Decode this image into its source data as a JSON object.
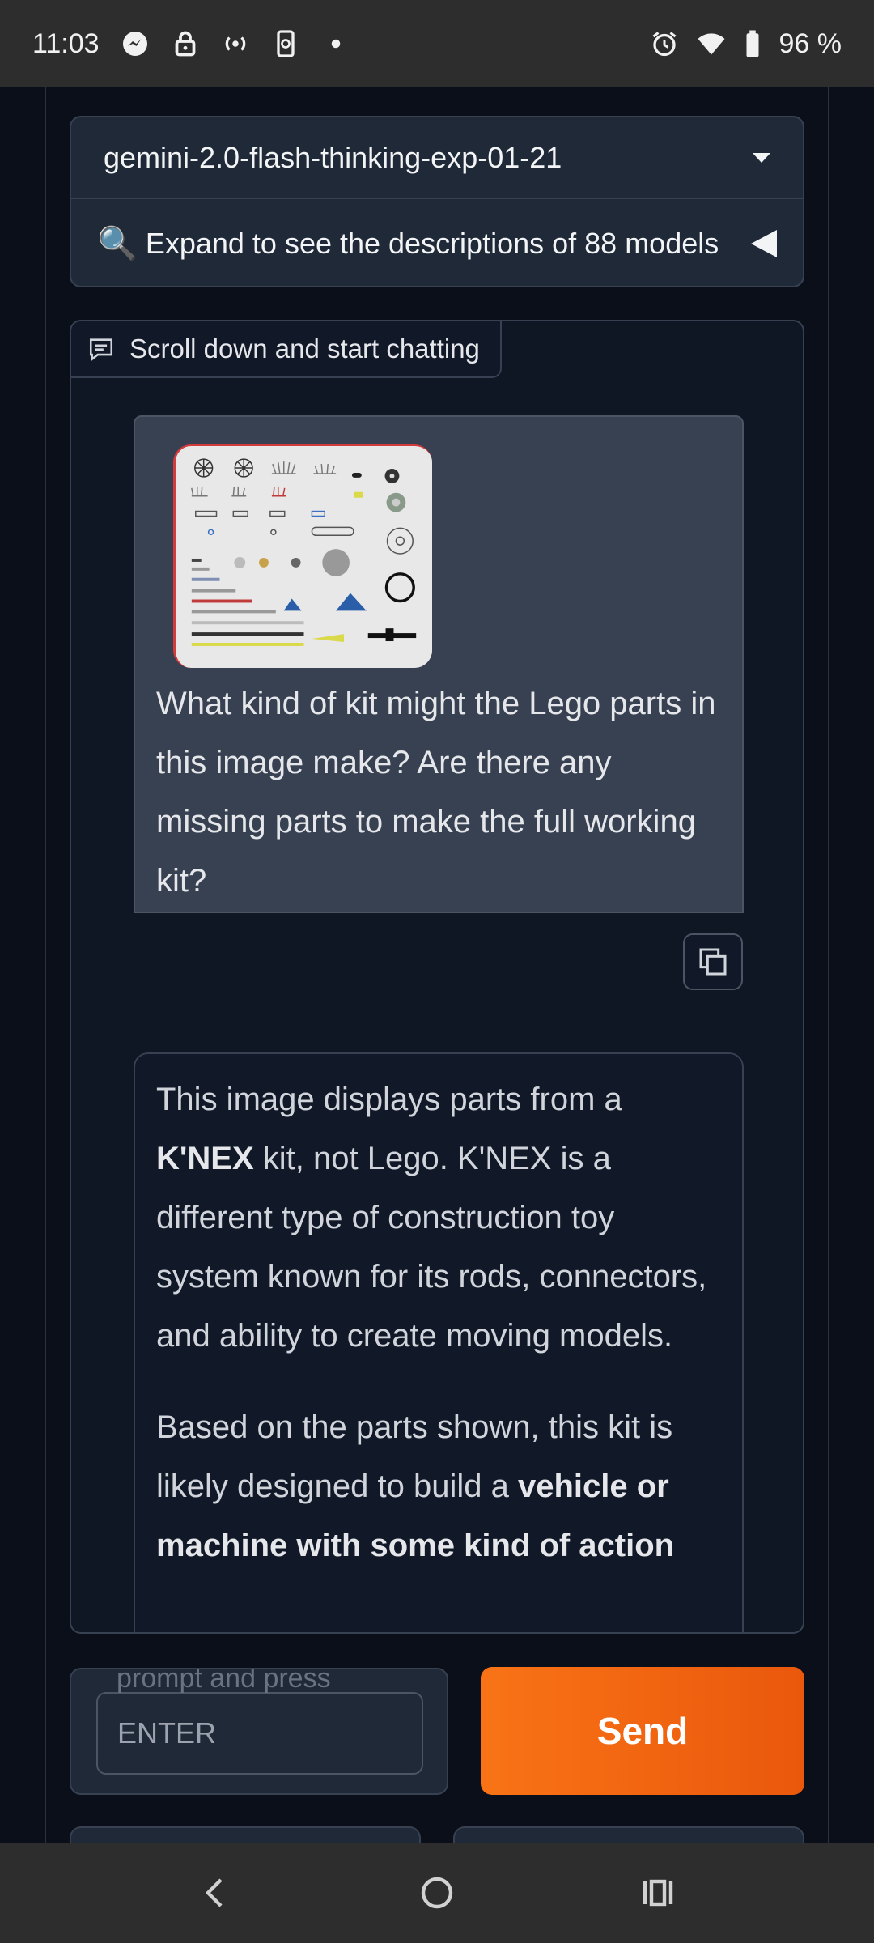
{
  "status_bar": {
    "time": "11:03",
    "battery": "96 %",
    "left_icons": [
      "messenger-icon",
      "lock-icon",
      "hotspot-icon",
      "phone-sync-icon",
      "dot-icon"
    ],
    "right_icons": [
      "alarm-icon",
      "wifi-icon",
      "battery-icon"
    ]
  },
  "model_selector": {
    "selected": "gemini-2.0-flash-thinking-exp-01-21",
    "expand_label": "Expand to see the descriptions of 88 models",
    "expand_icon": "🔍"
  },
  "chat": {
    "tab_label": "Scroll down and start chatting",
    "user_message": "What kind of kit might the Lego parts in this image make? Are there any missing parts to make the full working kit?",
    "bot_message": {
      "p1_strong": "K'NEX",
      "p1_pre": "This image displays parts from a ",
      "p1_post": " kit, not Lego. K'NEX is a different type of construction toy system known for its rods, connectors, and ability to create moving models.",
      "p2_pre": "Based on the parts shown, this kit is likely designed to build a ",
      "p2_strong": "vehicle or machine with some kind of action"
    }
  },
  "input": {
    "overflow_text": "prompt and press",
    "placeholder": "ENTER"
  },
  "send_label": "Send",
  "colors": {
    "background": "#0b0f19",
    "panel": "#1f2937",
    "accent": "#f97316"
  }
}
